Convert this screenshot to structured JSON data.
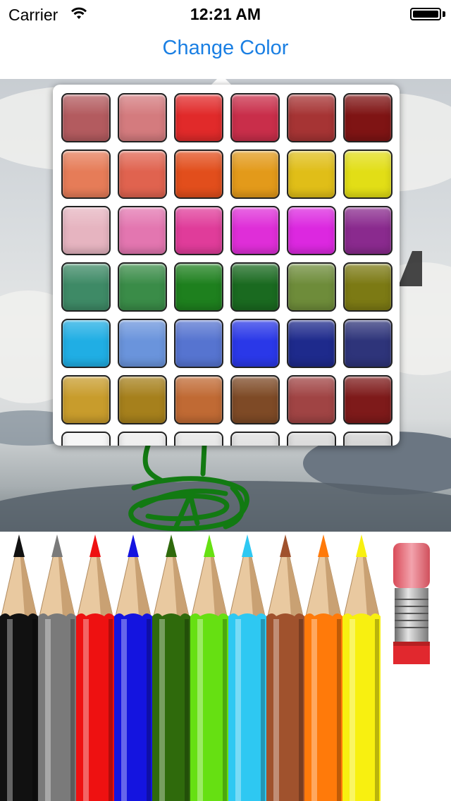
{
  "status_bar": {
    "carrier": "Carrier",
    "time": "12:21 AM"
  },
  "nav": {
    "change_color_label": "Change Color"
  },
  "palette": {
    "rows": [
      [
        "#b35b5f",
        "#d47b7e",
        "#e12a2a",
        "#c92e4a",
        "#a63434",
        "#7f1414"
      ],
      [
        "#e67c58",
        "#e0634f",
        "#e24e1c",
        "#e39a1a",
        "#e0be18",
        "#e2de16"
      ],
      [
        "#e6b4c0",
        "#e376b0",
        "#e03c9a",
        "#df2ed8",
        "#dc28e0",
        "#8a2a8e"
      ],
      [
        "#3e8a66",
        "#3a8c48",
        "#1e801e",
        "#1a6a20",
        "#6e8c3a",
        "#7c7a14"
      ],
      [
        "#20aee4",
        "#6a94dc",
        "#5674d0",
        "#2a38e8",
        "#1e2a8c",
        "#2e347a"
      ],
      [
        "#c89c2c",
        "#a6801c",
        "#c06a34",
        "#7e4a26",
        "#a04444",
        "#7e1a1a"
      ],
      [
        "#f4f4f4",
        "#ececec",
        "#e4e4e4",
        "#dedede",
        "#d6d6d6",
        "#cfcfcf"
      ]
    ]
  },
  "pencils": [
    {
      "name": "black",
      "color": "#111111"
    },
    {
      "name": "gray",
      "color": "#7a7a7a"
    },
    {
      "name": "red",
      "color": "#ee1111"
    },
    {
      "name": "blue",
      "color": "#1414e0"
    },
    {
      "name": "dark-green",
      "color": "#2f6a0c"
    },
    {
      "name": "lime-green",
      "color": "#66e012"
    },
    {
      "name": "sky-blue",
      "color": "#2ec8f2"
    },
    {
      "name": "brown",
      "color": "#a0522d"
    },
    {
      "name": "orange",
      "color": "#ff7a0a"
    },
    {
      "name": "yellow",
      "color": "#f8f010"
    }
  ],
  "icons": {
    "wifi": "wifi-icon",
    "battery": "battery-icon",
    "eraser": "eraser-icon"
  }
}
